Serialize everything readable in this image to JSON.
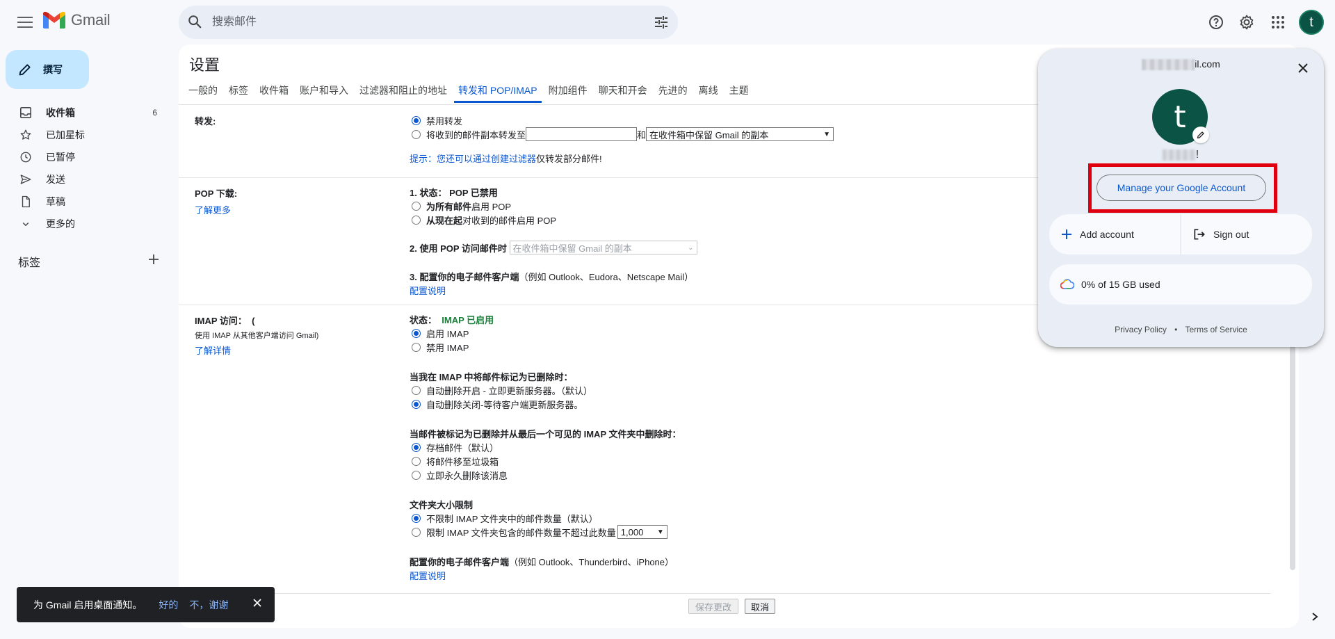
{
  "header": {
    "app_name": "Gmail",
    "search_placeholder": "搜索邮件",
    "avatar_letter": "t"
  },
  "sidebar": {
    "compose_label": "撰写",
    "items": [
      {
        "label": "收件箱",
        "count": "6",
        "icon": "inbox-icon",
        "bold": true
      },
      {
        "label": "已加星标",
        "icon": "star-icon"
      },
      {
        "label": "已暂停",
        "icon": "clock-icon"
      },
      {
        "label": "发送",
        "icon": "send-icon"
      },
      {
        "label": "草稿",
        "icon": "draft-icon"
      },
      {
        "label": "更多的",
        "icon": "chevron-down-icon"
      }
    ],
    "labels_title": "标签"
  },
  "settings": {
    "title": "设置",
    "tabs": [
      "一般的",
      "标签",
      "收件箱",
      "账户和导入",
      "过滤器和阻止的地址",
      "转发和 POP/IMAP",
      "附加组件",
      "聊天和开会",
      "先进的",
      "离线",
      "主题"
    ],
    "active_tab": "转发和 POP/IMAP",
    "forwarding": {
      "label": "转发:",
      "opt_disable": "禁用转发",
      "opt_forward_prefix": "将收到的邮件副本转发至",
      "and": "和",
      "keep_select": "在收件箱中保留 Gmail 的副本",
      "tip_prefix": "提示：您还可以通过",
      "tip_link": "创建过滤器",
      "tip_suffix": "仅转发部分邮件!"
    },
    "pop": {
      "label": "POP 下载:",
      "learn_more": "了解更多",
      "status_prefix": "1. 状态：",
      "status_value": "POP 已禁用",
      "opt_all_bold": "为所有邮件",
      "opt_all_rest": "启用 POP",
      "opt_now_bold": "从现在起",
      "opt_now_rest": "对收到的邮件启用 POP",
      "when_access": "2. 使用 POP 访问邮件时",
      "when_select": "在收件箱中保留 Gmail 的副本",
      "configure_bold": "3. 配置你的电子邮件客户端",
      "configure_rest": "（例如 Outlook、Eudora、Netscape Mail）",
      "config_link": "配置说明"
    },
    "imap": {
      "label": "IMAP 访问：",
      "label_paren": "(",
      "sub": "使用 IMAP 从其他客户端访问 Gmail)",
      "learn_more": "了解详情",
      "status_prefix": "状态：",
      "status_value": "IMAP 已启用",
      "opt_enable": "启用 IMAP",
      "opt_disable": "禁用 IMAP",
      "deleted_title": "当我在 IMAP 中将邮件标记为已删除时：",
      "del_opt1": "自动删除开启 - 立即更新服务器。（默认）",
      "del_opt2": "自动删除关闭-等待客户端更新服务器。",
      "expunge_title": "当邮件被标记为已删除并从最后一个可见的 IMAP 文件夹中删除时：",
      "exp_opt1": "存档邮件（默认）",
      "exp_opt2": "将邮件移至垃圾箱",
      "exp_opt3": "立即永久删除该消息",
      "folder_title": "文件夹大小限制",
      "folder_opt1": "不限制 IMAP 文件夹中的邮件数量（默认）",
      "folder_opt2": "限制 IMAP 文件夹包含的邮件数量不超过此数量",
      "folder_limit": "1,000",
      "configure_bold": "配置你的电子邮件客户端",
      "configure_rest": "（例如 Outlook、Thunderbird、iPhone）",
      "config_link": "配置说明"
    },
    "save_label": "保存更改",
    "cancel_label": "取消"
  },
  "snackbar": {
    "message": "为 Gmail 启用桌面通知。",
    "ok": "好的",
    "no": "不，谢谢"
  },
  "account_popup": {
    "email_suffix": "il.com",
    "avatar_letter": "t",
    "greeting_suffix": "!",
    "manage_label": "Manage your Google Account",
    "add_account": "Add account",
    "sign_out": "Sign out",
    "storage": "0% of 15 GB used",
    "privacy": "Privacy Policy",
    "dot": "•",
    "terms": "Terms of Service"
  },
  "colors": {
    "accent": "#0b57d0",
    "compose_bg": "#c2e7ff",
    "avatar_bg": "#0b5345",
    "highlight_border": "#e0000f",
    "status_green": "#188038"
  }
}
